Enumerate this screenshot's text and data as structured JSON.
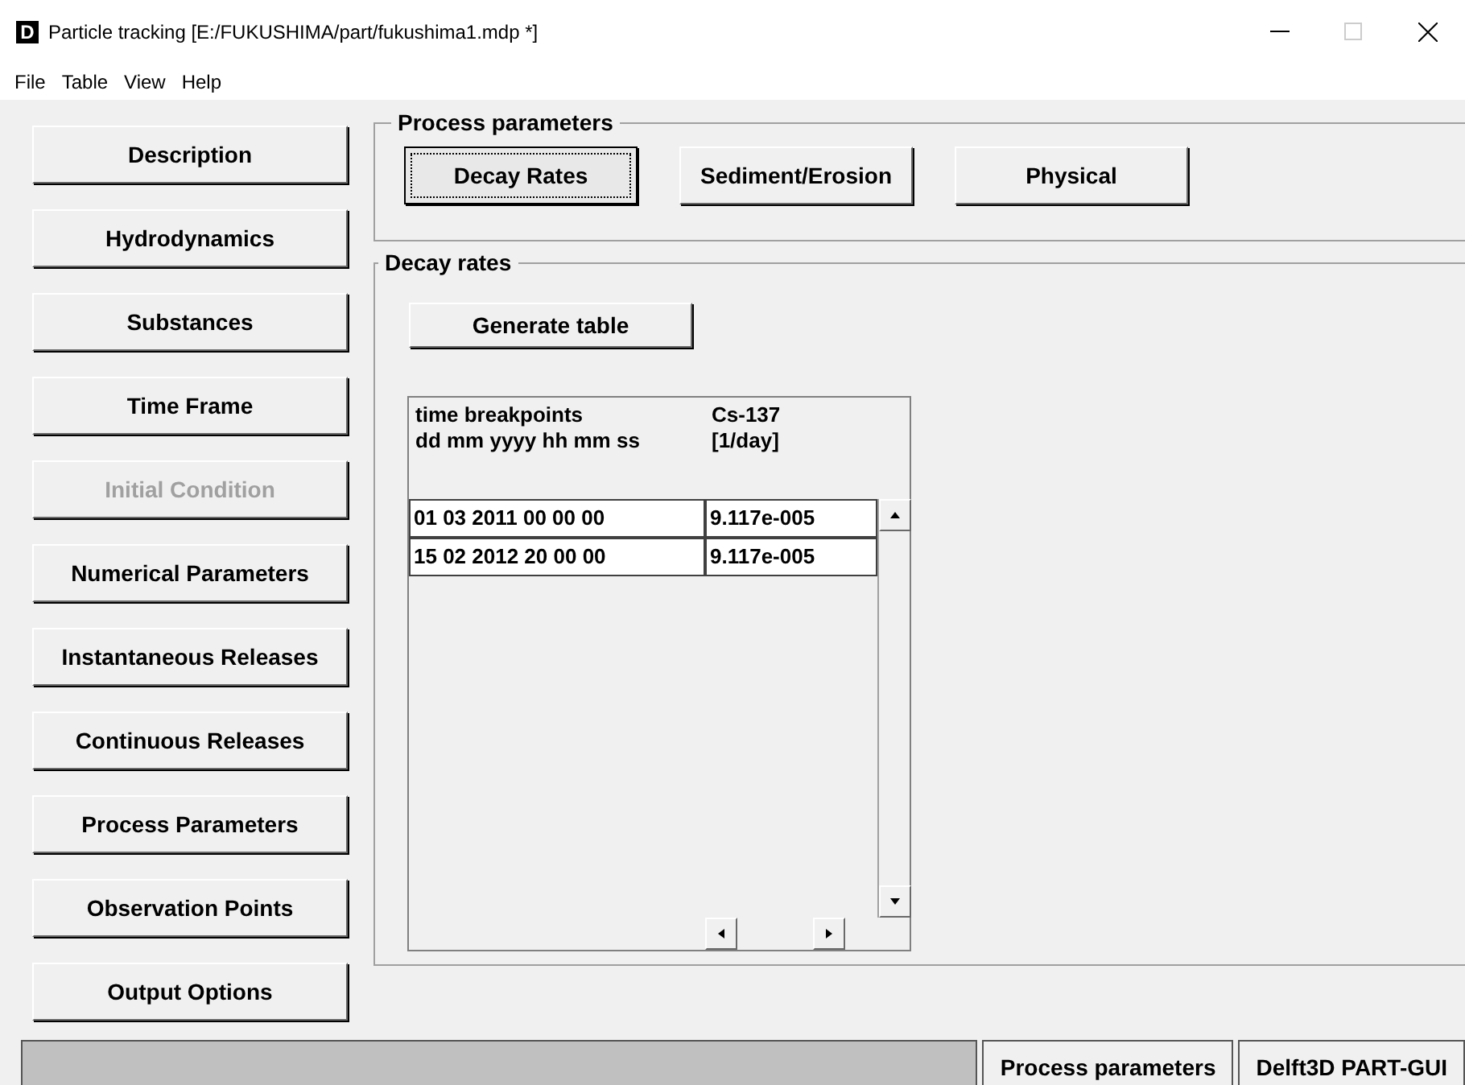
{
  "window": {
    "icon_letter": "D",
    "title": "Particle tracking  [E:/FUKUSHIMA/part/fukushima1.mdp  *]"
  },
  "menu": [
    "File",
    "Table",
    "View",
    "Help"
  ],
  "sidebar": {
    "items": [
      {
        "label": "Description",
        "disabled": false
      },
      {
        "label": "Hydrodynamics",
        "disabled": false
      },
      {
        "label": "Substances",
        "disabled": false
      },
      {
        "label": "Time Frame",
        "disabled": false
      },
      {
        "label": "Initial Condition",
        "disabled": true
      },
      {
        "label": "Numerical Parameters",
        "disabled": false
      },
      {
        "label": "Instantaneous Releases",
        "disabled": false
      },
      {
        "label": "Continuous Releases",
        "disabled": false
      },
      {
        "label": "Process Parameters",
        "disabled": false
      },
      {
        "label": "Observation Points",
        "disabled": false
      },
      {
        "label": "Output Options",
        "disabled": false
      }
    ]
  },
  "process_parameters": {
    "title": "Process parameters",
    "tabs": [
      {
        "label": "Decay Rates",
        "selected": true
      },
      {
        "label": "Sediment/Erosion",
        "selected": false
      },
      {
        "label": "Physical",
        "selected": false
      }
    ]
  },
  "decay_rates": {
    "title": "Decay  rates",
    "generate_button": "Generate table",
    "table": {
      "header_rows": [
        [
          "time breakpoints",
          "Cs-137"
        ],
        [
          "dd mm yyyy hh mm ss",
          "[1/day]"
        ]
      ],
      "rows": [
        [
          "01 03 2011 00 00 00",
          "9.117e-005"
        ],
        [
          "15 02 2012 20 00 00",
          "9.117e-005"
        ]
      ]
    }
  },
  "status_bar": [
    "Process parameters",
    "Delft3D PART-GUI"
  ]
}
